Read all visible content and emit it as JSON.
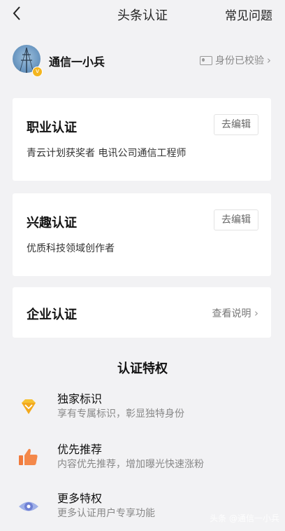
{
  "nav": {
    "title": "头条认证",
    "faq": "常见问题"
  },
  "user": {
    "name": "通信一小兵",
    "id_status": "身份已校验"
  },
  "cards": {
    "career": {
      "title": "职业认证",
      "button": "去编辑",
      "desc": "青云计划获奖者 电讯公司通信工程师"
    },
    "interest": {
      "title": "兴趣认证",
      "button": "去编辑",
      "desc": "优质科技领域创作者"
    },
    "enterprise": {
      "title": "企业认证",
      "link": "查看说明"
    }
  },
  "privileges": {
    "title": "认证特权",
    "items": [
      {
        "name": "独家标识",
        "desc": "享有专属标识，彰显独特身份",
        "icon": "diamond-badge-icon"
      },
      {
        "name": "优先推荐",
        "desc": "内容优先推荐，增加曝光快速涨粉",
        "icon": "thumbs-up-icon"
      },
      {
        "name": "更多特权",
        "desc": "更多认证用户专享功能",
        "icon": "eye-icon"
      }
    ]
  },
  "watermark": "头条 @通信一小兵",
  "colors": {
    "accent": "#f3b51f",
    "thumb": "#f07a3c",
    "eye": "#7d8ed8",
    "background": "#f2f2f4"
  }
}
